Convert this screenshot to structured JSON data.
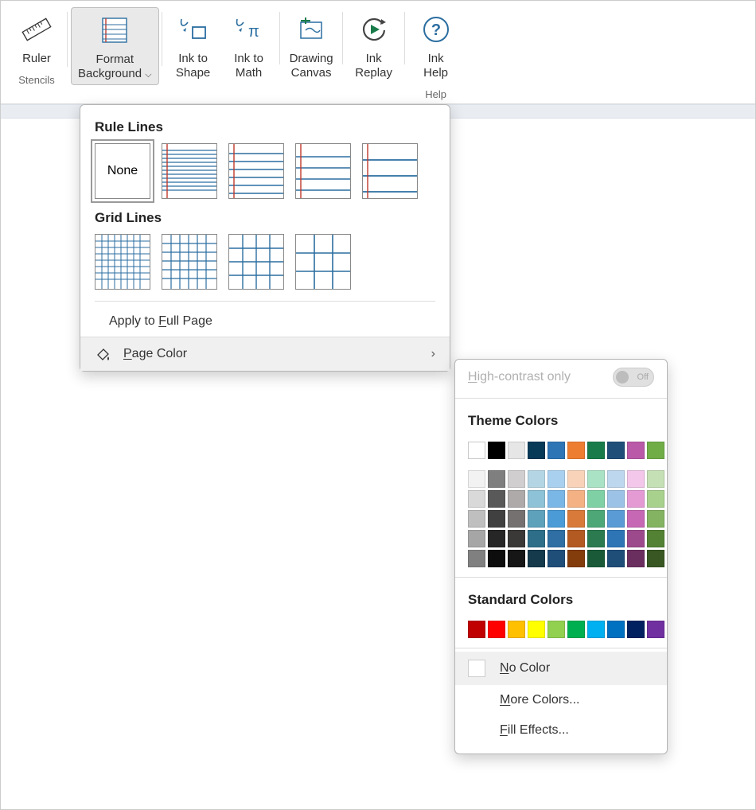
{
  "ribbon": {
    "ruler": {
      "label": "Ruler"
    },
    "format_bg": {
      "line1": "Format",
      "line2": "Background"
    },
    "ink_shape": {
      "line1": "Ink to",
      "line2": "Shape"
    },
    "ink_math": {
      "line1": "Ink to",
      "line2": "Math"
    },
    "drawing_canvas": {
      "line1": "Drawing",
      "line2": "Canvas"
    },
    "ink_replay": {
      "line1": "Ink",
      "line2": "Replay"
    },
    "ink_help": {
      "line1": "Ink",
      "line2": "Help"
    },
    "group_stencils": "Stencils",
    "group_help": "Help"
  },
  "dropdown": {
    "rule_title": "Rule Lines",
    "none_label": "None",
    "grid_title": "Grid Lines",
    "apply_full": "Apply to Full Page",
    "page_color": "Page Color"
  },
  "flyout": {
    "high_contrast": "High-contrast only",
    "toggle_state": "Off",
    "theme_title": "Theme Colors",
    "standard_title": "Standard Colors",
    "no_color": "No Color",
    "more_colors": "More Colors...",
    "fill_effects": "Fill Effects..."
  },
  "colors": {
    "theme_row": [
      "#ffffff",
      "#000000",
      "#e7e6e6",
      "#073a57",
      "#2e75b6",
      "#ed7d31",
      "#197b4a",
      "#1f4e79",
      "#b959a7",
      "#70ad47"
    ],
    "theme_tints": [
      [
        "#f2f2f2",
        "#7f7f7f",
        "#d0cece",
        "#b4d6e4",
        "#a9d1ef",
        "#f8d3b9",
        "#a9e2c4",
        "#bdd7ee",
        "#f2c7e9",
        "#c5e0b4"
      ],
      [
        "#d9d9d9",
        "#595959",
        "#aeaaaa",
        "#8ec2d6",
        "#7ab6e6",
        "#f4b183",
        "#7fd1a5",
        "#9cc3e6",
        "#e49bd4",
        "#a9d18e"
      ],
      [
        "#bfbfbf",
        "#404040",
        "#757171",
        "#5ea1bb",
        "#4a9bd6",
        "#d87a3a",
        "#4da777",
        "#5b9bd5",
        "#c668b4",
        "#84b362"
      ],
      [
        "#a6a6a6",
        "#262626",
        "#3b3838",
        "#2e6e89",
        "#2f6fa3",
        "#b35a23",
        "#2c7b50",
        "#2e75b6",
        "#9c4a8c",
        "#548235"
      ],
      [
        "#808080",
        "#0d0d0d",
        "#161616",
        "#143a4c",
        "#1f4e79",
        "#833c0c",
        "#1a5a38",
        "#1f4e79",
        "#6b2f5f",
        "#385723"
      ]
    ],
    "standard": [
      "#c00000",
      "#ff0000",
      "#ffc000",
      "#ffff00",
      "#92d050",
      "#00b050",
      "#00b0f0",
      "#0070c0",
      "#002060",
      "#7030a0"
    ]
  }
}
